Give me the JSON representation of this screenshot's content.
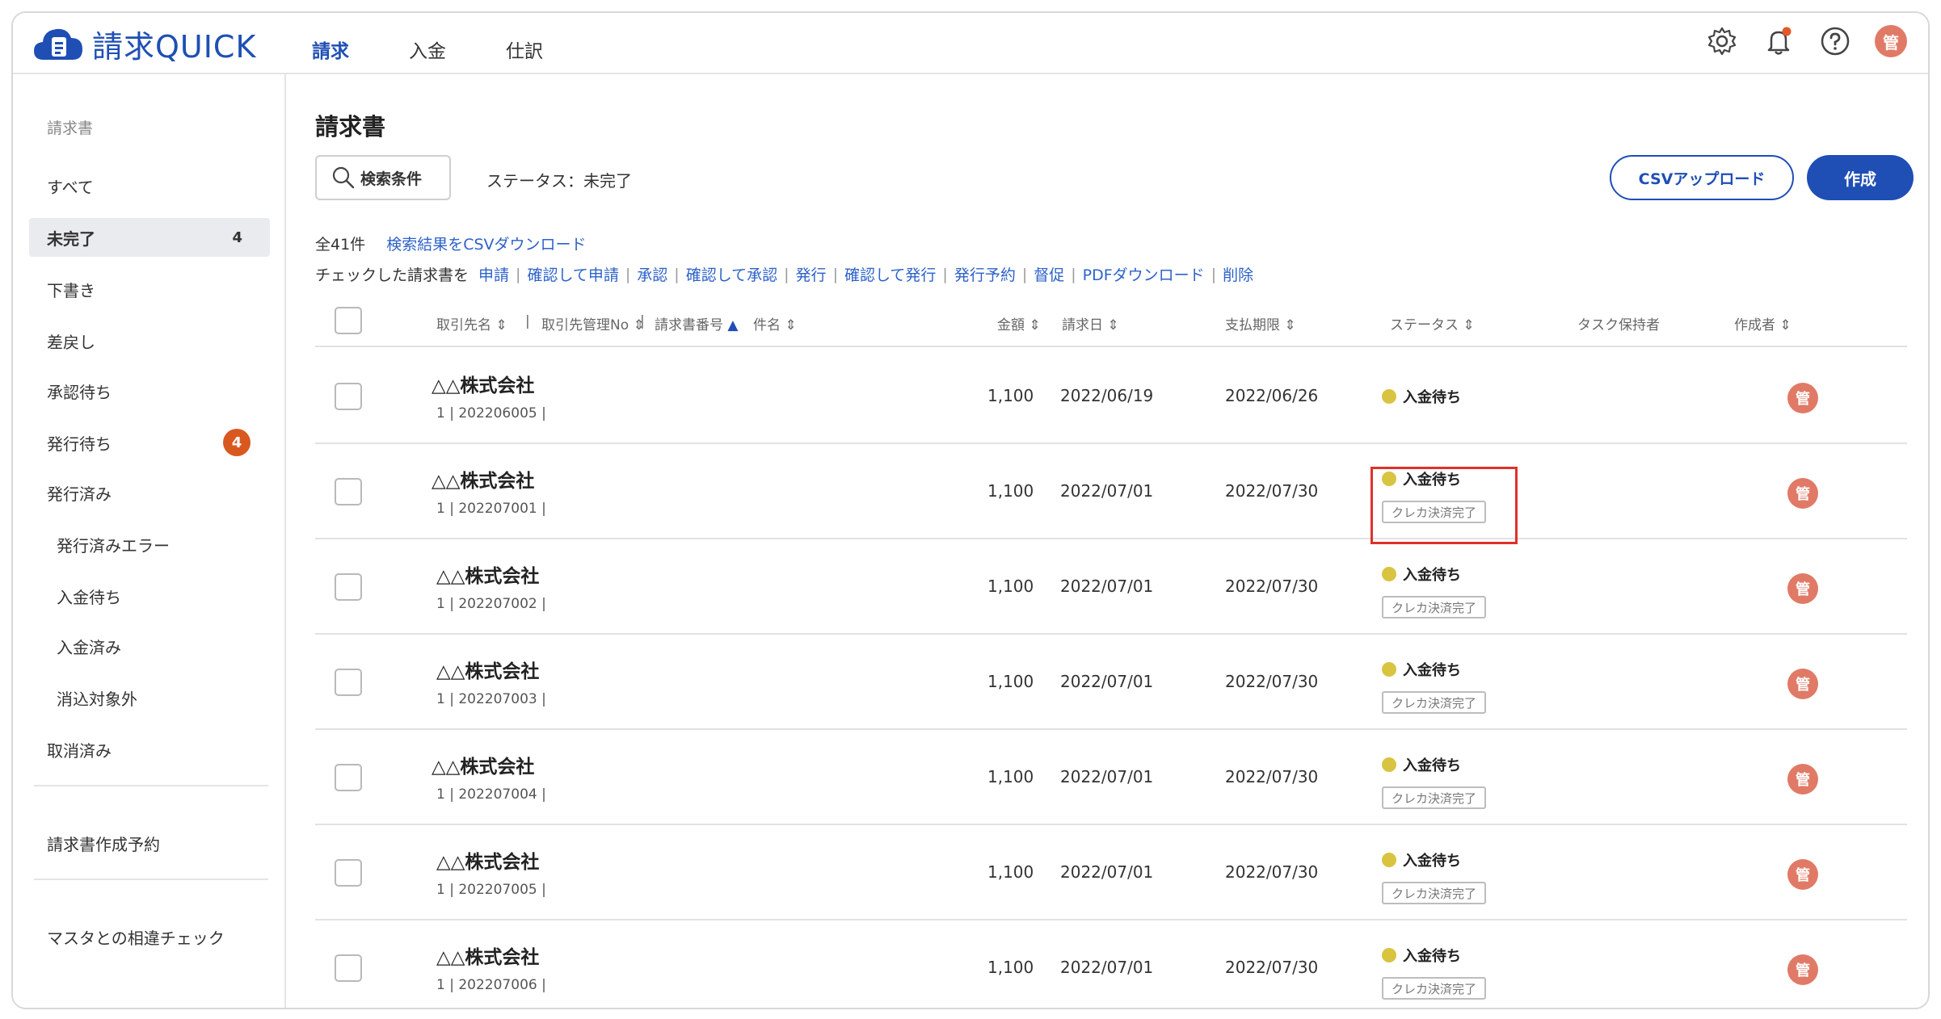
{
  "app": {
    "name": "請求QUICK"
  },
  "nav": {
    "tabs": [
      "請求",
      "入金",
      "仕訳"
    ]
  },
  "header_icons": {
    "settings": "gear-icon",
    "notifications": "bell-icon",
    "help": "help-icon",
    "user_initial": "管"
  },
  "sidebar": {
    "section_label": "請求書",
    "items": [
      {
        "label": "すべて"
      },
      {
        "label": "未完了",
        "count": "4"
      },
      {
        "label": "下書き"
      },
      {
        "label": "差戻し"
      },
      {
        "label": "承認待ち"
      },
      {
        "label": "発行待ち",
        "badge": "4"
      },
      {
        "label": "発行済み"
      },
      {
        "label": "発行済みエラー"
      },
      {
        "label": "入金待ち"
      },
      {
        "label": "入金済み"
      },
      {
        "label": "消込対象外"
      },
      {
        "label": "取消済み"
      }
    ],
    "extra": [
      {
        "label": "請求書作成予約"
      },
      {
        "label": "マスタとの相違チェック"
      }
    ]
  },
  "main": {
    "title": "請求書",
    "search_label": "検索条件",
    "status_filter": "ステータス：未完了",
    "csv_upload": "CSVアップロード",
    "create": "作成",
    "total": "全41件",
    "csv_download": "検索結果をCSVダウンロード",
    "bulk_prefix": "チェックした請求書を",
    "bulk_actions": [
      "申請",
      "確認して申請",
      "承認",
      "確認して承認",
      "発行",
      "確認して発行",
      "発行予約",
      "督促",
      "PDFダウンロード",
      "削除"
    ]
  },
  "table": {
    "columns": {
      "client": "取引先名",
      "client_no": "取引先管理No",
      "invoice_no": "請求書番号",
      "subject": "件名",
      "amount": "金額",
      "invoice_date": "請求日",
      "due_date": "支払期限",
      "status": "ステータス",
      "task_owner": "タスク保持者",
      "creator": "作成者"
    },
    "rows": [
      {
        "company": "△△株式会社",
        "sub": "1 | 202206005 |",
        "amount": "1,100",
        "date": "2022/06/19",
        "due": "2022/06/26",
        "status": "入金待ち",
        "tag": "",
        "creator": "管"
      },
      {
        "company": "△△株式会社",
        "sub": "1 | 202207001 |",
        "amount": "1,100",
        "date": "2022/07/01",
        "due": "2022/07/30",
        "status": "入金待ち",
        "tag": "クレカ決済完了",
        "creator": "管"
      },
      {
        "company": "△△株式会社",
        "sub": "1 | 202207002 |",
        "amount": "1,100",
        "date": "2022/07/01",
        "due": "2022/07/30",
        "status": "入金待ち",
        "tag": "クレカ決済完了",
        "creator": "管"
      },
      {
        "company": "△△株式会社",
        "sub": "1 | 202207003 |",
        "amount": "1,100",
        "date": "2022/07/01",
        "due": "2022/07/30",
        "status": "入金待ち",
        "tag": "クレカ決済完了",
        "creator": "管"
      },
      {
        "company": "△△株式会社",
        "sub": "1 | 202207004 |",
        "amount": "1,100",
        "date": "2022/07/01",
        "due": "2022/07/30",
        "status": "入金待ち",
        "tag": "クレカ決済完了",
        "creator": "管"
      },
      {
        "company": "△△株式会社",
        "sub": "1 | 202207005 |",
        "amount": "1,100",
        "date": "2022/07/01",
        "due": "2022/07/30",
        "status": "入金待ち",
        "tag": "クレカ決済完了",
        "creator": "管"
      },
      {
        "company": "△△株式会社",
        "sub": "1 | 202207006 |",
        "amount": "1,100",
        "date": "2022/07/01",
        "due": "2022/07/30",
        "status": "入金待ち",
        "tag": "クレカ決済完了",
        "creator": "管"
      }
    ]
  },
  "colors": {
    "brand": "#1f4fb5",
    "link": "#2e62c9",
    "status_dot": "#d8c440",
    "avatar": "#e07a66",
    "badge": "#d9581f",
    "highlight": "#e0302a"
  }
}
